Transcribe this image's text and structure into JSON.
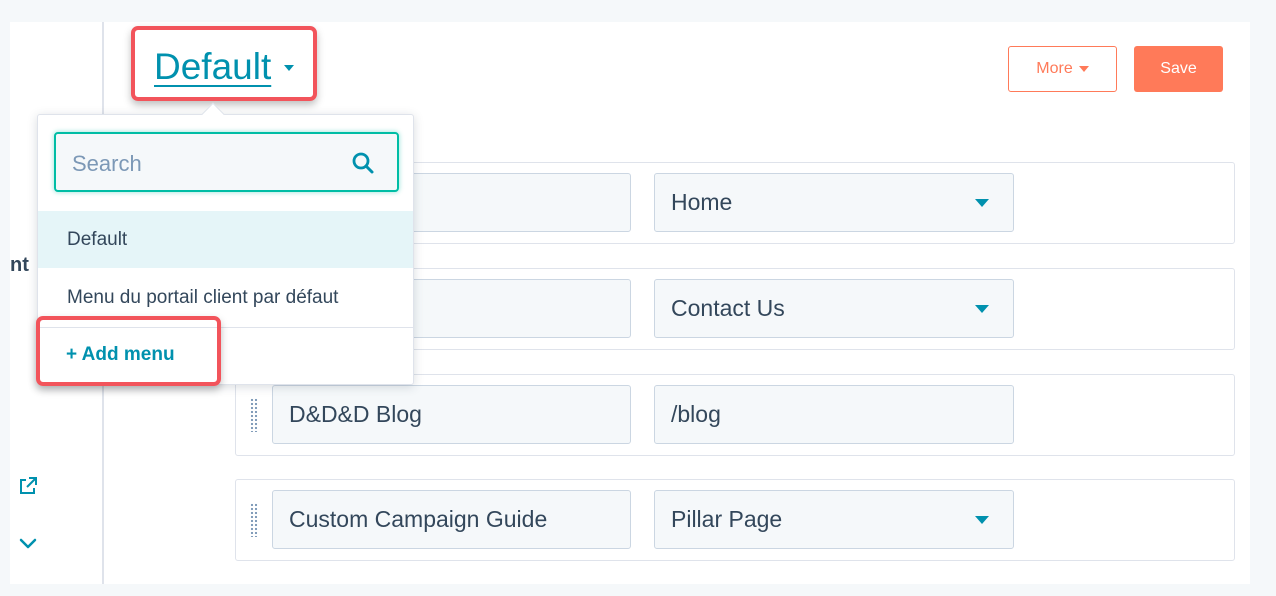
{
  "sidebar": {
    "truncated_label": "nt"
  },
  "header": {
    "menu_title": "Default",
    "more_label": "More",
    "save_label": "Save"
  },
  "dropdown": {
    "search_placeholder": "Search",
    "items": [
      {
        "label": "Default",
        "selected": true
      },
      {
        "label": "Menu du portail client par défaut",
        "selected": false
      }
    ],
    "add_menu_label": "+ Add menu"
  },
  "rows": [
    {
      "label": "",
      "link": "Home",
      "link_is_dropdown": true
    },
    {
      "label": "",
      "link": "Contact Us",
      "link_is_dropdown": true
    },
    {
      "label": "D&D&D Blog",
      "link": "/blog",
      "link_is_dropdown": false
    },
    {
      "label": "Custom Campaign Guide",
      "link": "Pillar Page",
      "link_is_dropdown": true
    }
  ],
  "colors": {
    "accent": "#0091ae",
    "primary_button": "#ff7a59",
    "highlight_box": "#f2545b",
    "selected_item_bg": "#e5f5f8"
  },
  "icons": [
    "external-link-icon",
    "chevron-down-icon",
    "search-icon",
    "drag-handle-icon",
    "caret-down-icon"
  ]
}
